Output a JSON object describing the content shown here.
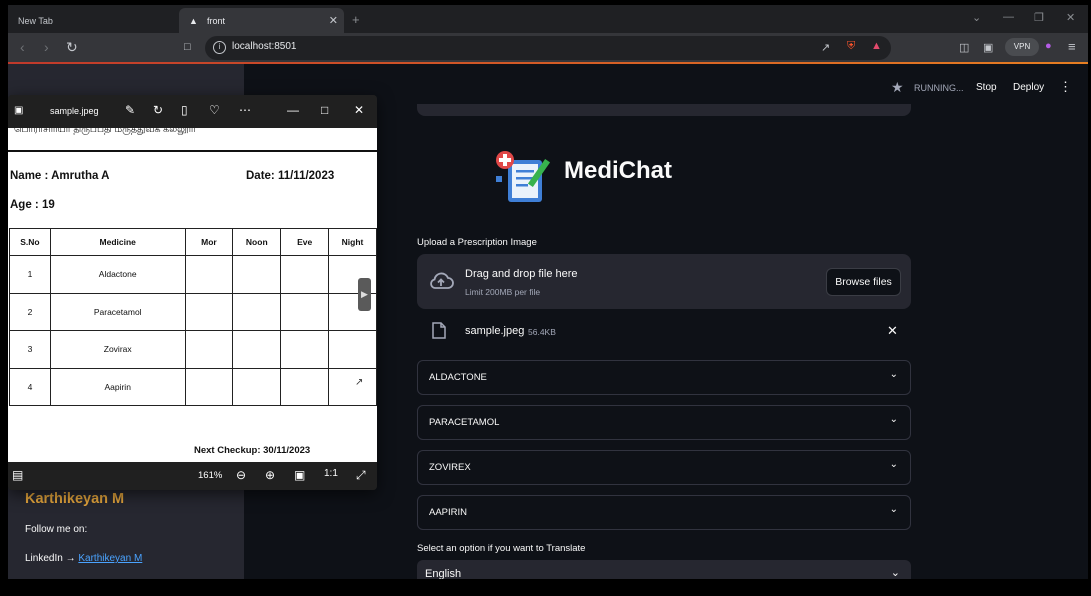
{
  "browser": {
    "tabs": [
      {
        "title": "New Tab",
        "active": false
      },
      {
        "title": "front",
        "active": true
      }
    ],
    "address": "localhost:8501",
    "vpn_label": "VPN"
  },
  "app": {
    "status": "RUNNING...",
    "stop_label": "Stop",
    "deploy_label": "Deploy",
    "title": "MediChat",
    "upload": {
      "label": "Upload a Prescription Image",
      "drop_title": "Drag and drop file here",
      "limit": "Limit 200MB per file",
      "browse_label": "Browse files"
    },
    "uploaded_file": {
      "name": "sample.jpeg",
      "size": "56.4KB"
    },
    "expanders": [
      "ALDACTONE",
      "PARACETAMOL",
      "ZOVIREX",
      "AAPIRIN"
    ],
    "translate": {
      "label": "Select an option if you want to Translate",
      "selected": "English"
    },
    "sidebar": {
      "name": "Karthikeyan M",
      "follow": "Follow me on:",
      "linkedin_prefix": "LinkedIn → ",
      "linkedin_link": "Karthikeyan M"
    }
  },
  "viewer": {
    "filename": "sample.jpeg",
    "zoom": "161%",
    "document": {
      "header": "பொராசிரியர் திருப்பதி மருத்துவக் கல்லூரி",
      "name": "Name : Amrutha A",
      "date": "Date: 11/11/2023",
      "age": "Age : 19",
      "columns": [
        "S.No",
        "Medicine",
        "Mor",
        "Noon",
        "Eve",
        "Night"
      ],
      "rows": [
        [
          "1",
          "Aldactone",
          "",
          "",
          "",
          ""
        ],
        [
          "2",
          "Paracetamol",
          "",
          "",
          "",
          ""
        ],
        [
          "3",
          "Zovirax",
          "",
          "",
          "",
          ""
        ],
        [
          "4",
          "Aapirin",
          "",
          "",
          "",
          ""
        ]
      ],
      "checkup": "Next Checkup: 30/11/2023"
    }
  }
}
